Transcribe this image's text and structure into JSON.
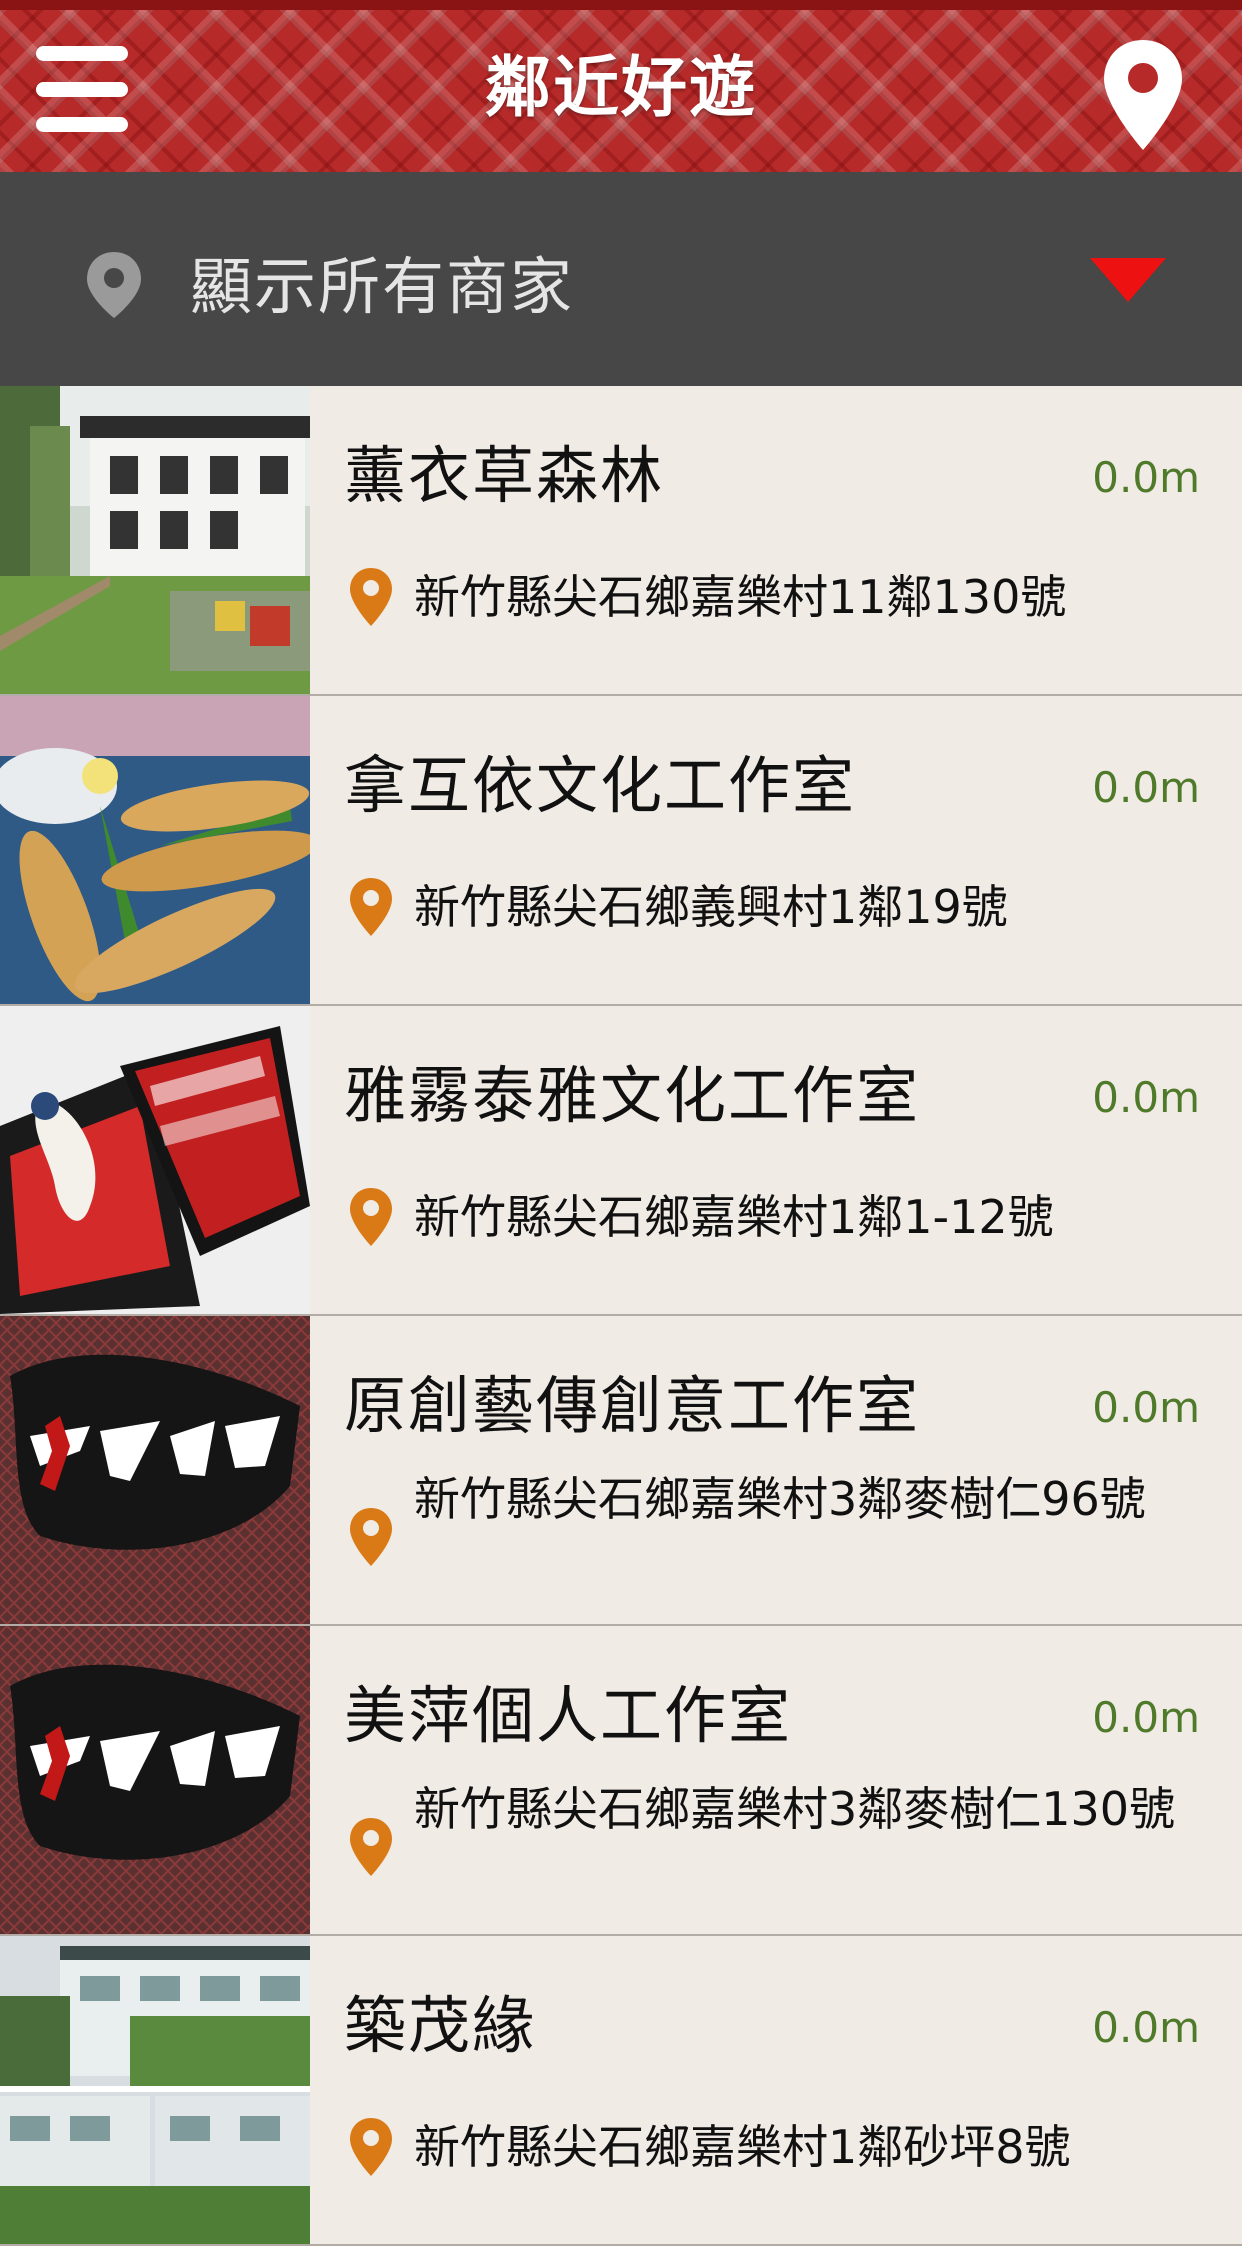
{
  "app": {
    "title": "鄰近好遊",
    "menu_icon": "hamburger-menu-icon",
    "location_icon": "map-pin-icon"
  },
  "filter": {
    "label": "顯示所有商家",
    "icon": "location-pin-icon",
    "dropdown_icon": "triangle-down-icon"
  },
  "colors": {
    "header_red": "#b72a2a",
    "filter_bar": "#474747",
    "list_bg": "#f1ebe6",
    "distance_green": "#4f7a2a",
    "address_pin_orange": "#d97a16",
    "dropdown_red": "#ee1111"
  },
  "shops": [
    {
      "name": "薰衣草森林",
      "distance": "0.0m",
      "address": "新竹縣尖石鄉嘉樂村11鄰130號",
      "image": "lodge-building-photo"
    },
    {
      "name": "拿互依文化工作室",
      "distance": "0.0m",
      "address": "新竹縣尖石鄉義興村1鄰19號",
      "image": "bird-millet-craft-photo"
    },
    {
      "name": "雅霧泰雅文化工作室",
      "distance": "0.0m",
      "address": "新竹縣尖石鄉嘉樂村1鄰1-12號",
      "image": "tooth-pendant-box-photo"
    },
    {
      "name": "原創藝傳創意工作室",
      "distance": "0.0m",
      "address": "新竹縣尖石鄉嘉樂村3鄰麥樹仁96號",
      "image": "jianshi-logo"
    },
    {
      "name": "美萍個人工作室",
      "distance": "0.0m",
      "address": "新竹縣尖石鄉嘉樂村3鄰麥樹仁130號",
      "image": "jianshi-logo"
    },
    {
      "name": "築茂緣",
      "distance": "0.0m",
      "address": "新竹縣尖石鄉嘉樂村1鄰砂坪8號",
      "image": "hotel-buildings-photo"
    }
  ]
}
